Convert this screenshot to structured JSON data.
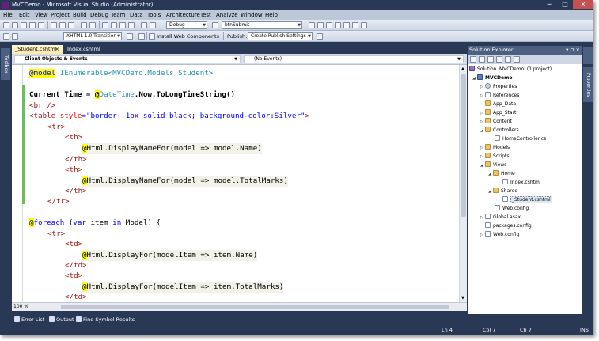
{
  "window": {
    "title": "MVCDemo - Microsoft Visual Studio (Administrator)",
    "min_glyph": "─",
    "max_glyph": "□",
    "close_glyph": "✕"
  },
  "menu": [
    "File",
    "Edit",
    "View",
    "Project",
    "Build",
    "Debug",
    "Team",
    "Data",
    "Tools",
    "Architecture",
    "Test",
    "Analyze",
    "Window",
    "Help"
  ],
  "toolbar": {
    "config": "Debug",
    "target": "btnSubmit",
    "schema": "XHTML 1.0 Transition",
    "install_web_components": "Install Web Components",
    "publish_label": "Publish:",
    "publish_settings": "Create Publish Settings"
  },
  "editor": {
    "tabs": [
      {
        "label": "_Student.cshtml",
        "close": "×"
      },
      {
        "label": "Index.cshtml"
      }
    ],
    "nav_left": "Client Objects & Events",
    "nav_right": "(No Events)",
    "zoom": "100 %",
    "code": {
      "l1_razor": "@model",
      "l1_rest": " IEnumerable<MVCDemo.Models.Student>",
      "l2a": "Current Time = ",
      "l2_razor": "@",
      "l2_type": "DateTime",
      "l2b": ".Now.ToLongTimeString()",
      "l3": "<br />",
      "l4_tag": "<table",
      "l4_attr": " style",
      "l4_eq": "=",
      "l4_val": "\"border: 1px solid black; background-color:Silver\"",
      "l4_close": ">",
      "l5": "<tr>",
      "l6": "<th>",
      "l7_razor": "@",
      "l7_rest": "Html.DisplayNameFor(model => model.Name)",
      "l8": "</th>",
      "l9": "<th>",
      "l10_razor": "@",
      "l10_rest": "Html.DisplayNameFor(model => model.TotalMarks)",
      "l11": "</th>",
      "l12": "</tr>",
      "l13_razor": "@",
      "l13_kw": "foreach",
      "l13_a": " (",
      "l13_kw2": "var",
      "l13_b": " item ",
      "l13_kw3": "in",
      "l13_c": " Model) {",
      "l14": "<tr>",
      "l15": "<td>",
      "l16_razor": "@",
      "l16_rest": "Html.DisplayFor(modelItem => item.Name)",
      "l17": "</td>",
      "l18": "<td>",
      "l19_razor": "@",
      "l19_rest": "Html.DisplayFor(modelItem => item.TotalMarks)",
      "l20": "</td>"
    }
  },
  "left_strip": {
    "label": "Toolbox"
  },
  "right_strip": {
    "label": "Properties"
  },
  "solution_explorer": {
    "title": "Solution Explorer",
    "pin": "▾ ⊓ ×",
    "nodes": [
      {
        "label": "Solution 'MVCDemo' (1 project)",
        "icon": "solution-icon"
      },
      {
        "label": "MVCDemo",
        "icon": "project-icon"
      },
      {
        "label": "Properties",
        "icon": "properties-icon"
      },
      {
        "label": "References",
        "icon": "references-icon"
      },
      {
        "label": "App_Data",
        "icon": "folder-icon"
      },
      {
        "label": "App_Start",
        "icon": "folder-icon"
      },
      {
        "label": "Content",
        "icon": "folder-icon"
      },
      {
        "label": "Controllers",
        "icon": "folder-icon"
      },
      {
        "label": "HomeController.cs",
        "icon": "file-icon"
      },
      {
        "label": "Models",
        "icon": "folder-icon"
      },
      {
        "label": "Scripts",
        "icon": "folder-icon"
      },
      {
        "label": "Views",
        "icon": "folder-icon"
      },
      {
        "label": "Home",
        "icon": "folder-icon"
      },
      {
        "label": "Index.cshtml",
        "icon": "file-icon"
      },
      {
        "label": "Shared",
        "icon": "folder-icon"
      },
      {
        "label": "_Student.cshtml",
        "icon": "file-icon"
      },
      {
        "label": "Web.config",
        "icon": "file-icon"
      },
      {
        "label": "Global.asax",
        "icon": "file-icon"
      },
      {
        "label": "packages.config",
        "icon": "file-icon"
      },
      {
        "label": "Web.config",
        "icon": "file-icon"
      }
    ]
  },
  "bottom_tabs": [
    "Error List",
    "Output",
    "Find Symbol Results"
  ],
  "status": {
    "ln": "Ln 4",
    "col": "Col 7",
    "ch": "Ch 7",
    "mode": "INS"
  },
  "colors": {
    "chrome": "#293955",
    "razor_highlight": "#ffff00",
    "keyword": "#0000ff",
    "html_tag": "#a31515",
    "attribute": "#ff0000",
    "type": "#2b91af"
  }
}
